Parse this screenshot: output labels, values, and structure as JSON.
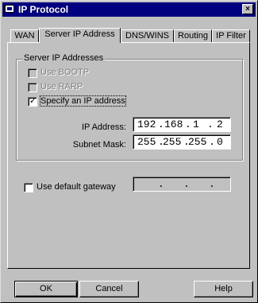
{
  "window": {
    "title": "IP Protocol",
    "close_label": "×"
  },
  "tabs": [
    {
      "label": "WAN",
      "active": false
    },
    {
      "label": "Server IP Address",
      "active": true
    },
    {
      "label": "DNS/WINS",
      "active": false
    },
    {
      "label": "Routing",
      "active": false
    },
    {
      "label": "IP Filter",
      "active": false
    }
  ],
  "group": {
    "title": "Server IP Addresses",
    "options": [
      {
        "label": "Use BOOTP",
        "checked": false,
        "enabled": false
      },
      {
        "label": "Use RARP",
        "checked": false,
        "enabled": false
      },
      {
        "label": "Specify an IP address",
        "checked": true,
        "enabled": true
      }
    ],
    "ip_address": {
      "label": "IP Address:",
      "octets": [
        "192",
        "168",
        "1",
        "2"
      ]
    },
    "subnet_mask": {
      "label": "Subnet Mask:",
      "octets": [
        "255",
        "255",
        "255",
        "0"
      ]
    }
  },
  "gateway": {
    "label": "Use default gateway",
    "checked": false,
    "octets": [
      "",
      "",
      "",
      ""
    ]
  },
  "buttons": {
    "ok": "OK",
    "cancel": "Cancel",
    "help": "Help"
  },
  "check_glyph": "✓"
}
